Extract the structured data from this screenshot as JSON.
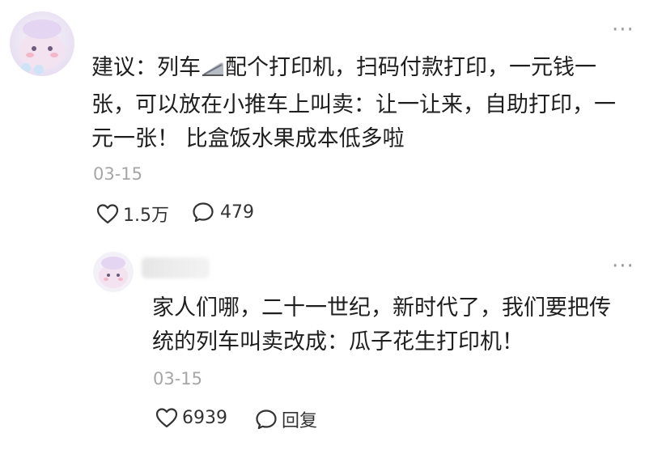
{
  "comment": {
    "text_before_icon": "建议：列车",
    "text_after_icon": "配个打印机，扫码付款打印，一元钱一",
    "line2": "张，可以放在小推车上叫卖：让一让来，自助打印，一",
    "line3": "元一张！ 比盒饭水果成本低多啦",
    "inline_icon": "train-icon",
    "date": "03-15",
    "likes": "1.5万",
    "comments": "479",
    "more": "···"
  },
  "reply": {
    "line1": "家人们哪，二十一世纪，新时代了，我们要把传",
    "line2": "统的列车叫卖改成：瓜子花生打印机！",
    "date": "03-15",
    "likes": "6939",
    "reply_label": "回复",
    "more": "···"
  },
  "icons": {
    "heart": "heart-icon",
    "bubble": "comment-bubble-icon"
  }
}
